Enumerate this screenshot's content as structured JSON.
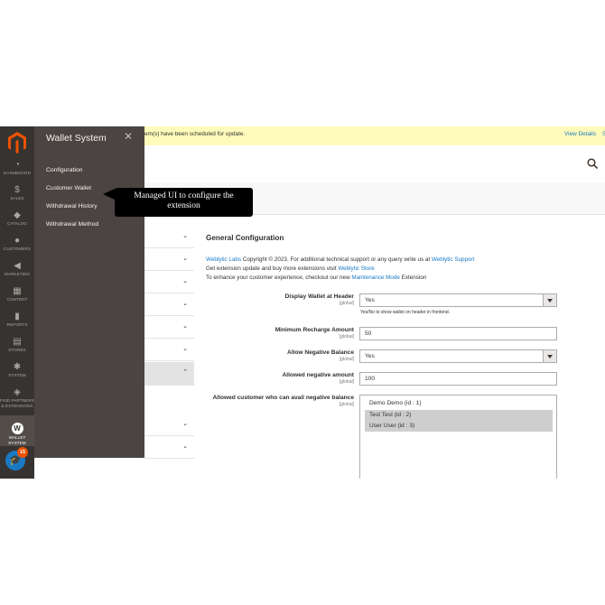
{
  "admin_menu": {
    "items": [
      {
        "label": "Dashboard",
        "icon": "dashboard-icon",
        "glyph": "◔"
      },
      {
        "label": "Sales",
        "icon": "dollar-icon",
        "glyph": "$"
      },
      {
        "label": "Catalog",
        "icon": "cube-icon",
        "glyph": "◆"
      },
      {
        "label": "Customers",
        "icon": "customers-icon",
        "glyph": "●"
      },
      {
        "label": "Marketing",
        "icon": "megaphone-icon",
        "glyph": "◀"
      },
      {
        "label": "Content",
        "icon": "content-icon",
        "glyph": "▦"
      },
      {
        "label": "Reports",
        "icon": "bar-chart-icon",
        "glyph": "▮"
      },
      {
        "label": "Stores",
        "icon": "store-icon",
        "glyph": "▤"
      },
      {
        "label": "System",
        "icon": "gear-icon",
        "glyph": "✱"
      },
      {
        "label_line1": "Find Partners",
        "label_line2": "& Extensions",
        "icon": "partners-icon",
        "glyph": "◈"
      },
      {
        "label_line1": "Wallet",
        "label_line2": "System",
        "icon": "wallet-icon",
        "glyph": "W"
      }
    ],
    "help_badge": "15",
    "help_icon": "graduation-cap-icon"
  },
  "submenu": {
    "title": "Wallet System",
    "close_glyph": "✕",
    "links": [
      "Configuration",
      "Customer Wallet",
      "Withdrawal History",
      "Withdrawal Method"
    ]
  },
  "notice": {
    "text": "em(s) have been scheduled for update.",
    "link": "View Details",
    "more": "S"
  },
  "callout": {
    "line1": "Managed UI to configure the",
    "line2": "extension"
  },
  "main": {
    "section_title": "General Configuration",
    "info": {
      "line1_link": "Weblytic Labs",
      "line1_text": " Copyright © 2023. For additional technical support or any query write us at ",
      "line1_link2": "Weblytic Support",
      "line2_text": "Get extension update and buy more extensions visit ",
      "line2_link": "Weblytic Store",
      "line3_text": "To enhance your customer experience, checkout our new ",
      "line3_link": "Maintenance Mode",
      "line3_tail": " Extension"
    },
    "fields": {
      "display_wallet": {
        "label": "Display Wallet at Header",
        "scope": "[global]",
        "value": "Yes",
        "note": "Yes/No to show wallet on header in frontend."
      },
      "min_recharge": {
        "label": "Minimum Recharge Amount",
        "scope": "[global]",
        "value": "50"
      },
      "allow_negative": {
        "label": "Allow Negative Balance",
        "scope": "[global]",
        "value": "Yes"
      },
      "allowed_negative_amount": {
        "label": "Allowed negative amount",
        "scope": "[global]",
        "value": "100"
      },
      "allowed_customers": {
        "label": "Allowed customer who can avail negative balance",
        "scope": "[global]",
        "options": [
          {
            "text": "Demo Demo (id : 1)",
            "selected": false
          },
          {
            "text": "Test Test (id : 2)",
            "selected": true
          },
          {
            "text": "User User (id : 3)",
            "selected": true
          }
        ]
      }
    }
  },
  "colors": {
    "admin_bg": "#373330",
    "submenu_bg": "#4a4542",
    "notice_bg": "#fffbbb",
    "link": "#1979c3",
    "badge": "#eb5202"
  }
}
